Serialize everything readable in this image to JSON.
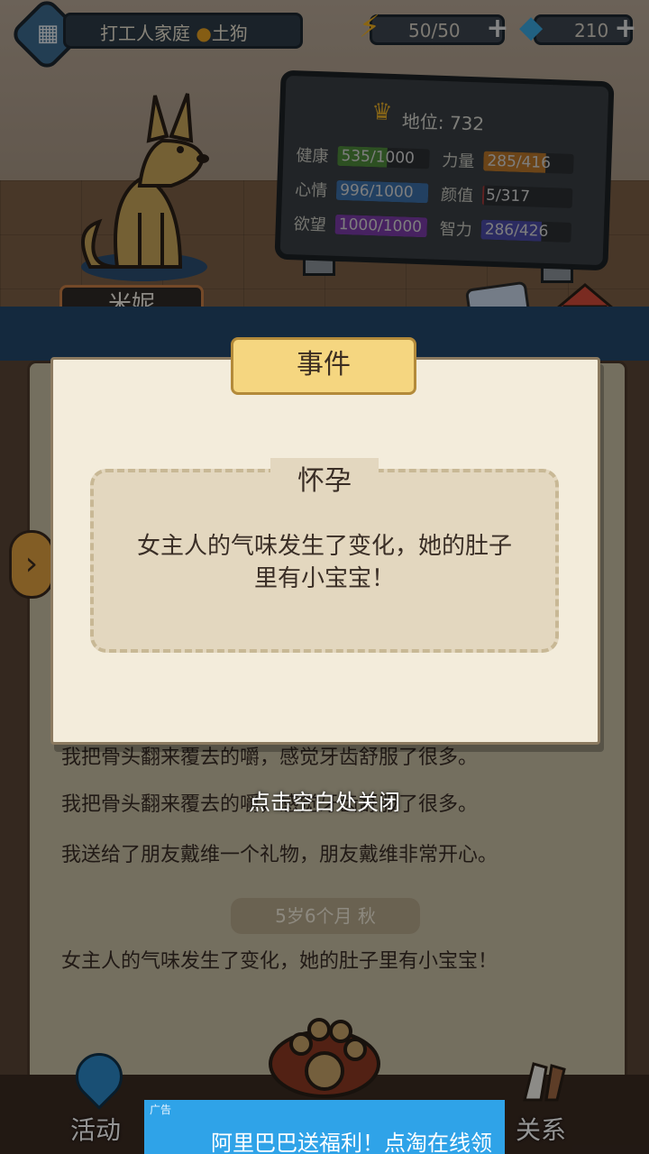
{
  "top_bar": {
    "family_name": "打工人家庭",
    "breed": "土狗",
    "energy": "50/50",
    "gems": "210"
  },
  "dog": {
    "name": "米妮"
  },
  "status": {
    "title": "地位: 732",
    "stats_left": [
      {
        "label": "健康",
        "value": "535/1000",
        "level": 0.535,
        "color": "#4f8a3c"
      },
      {
        "label": "心情",
        "value": "996/1000",
        "level": 0.996,
        "color": "#3c6fa8"
      },
      {
        "label": "欲望",
        "value": "1000/1000",
        "level": 1.0,
        "color": "#7a3ca8"
      }
    ],
    "stats_right": [
      {
        "label": "力量",
        "value": "285/416",
        "level": 0.685,
        "color": "#b8762a"
      },
      {
        "label": "颜值",
        "value": "5/317",
        "level": 0.016,
        "color": "#a83c3c"
      },
      {
        "label": "智力",
        "value": "286/426",
        "level": 0.671,
        "color": "#4a4aa8"
      }
    ]
  },
  "side_icons": {
    "task": "任务",
    "kennel": "狗窝"
  },
  "event": {
    "header": "事件",
    "title": "怀孕",
    "body": "女主人的气味发生了变化，她的肚子里有小宝宝！"
  },
  "log": {
    "lines": [
      "我把骨头翻来覆去的嚼，感觉牙齿舒服了很多。",
      "我把骨头翻来覆去的嚼，感觉牙齿舒服了很多。",
      "我送给了朋友戴维一个礼物，朋友戴维非常开心。"
    ],
    "date": "5岁6个月 秋",
    "last_line": "女主人的气味发生了变化，她的肚子里有小宝宝！"
  },
  "close_hint": "点击空白处关闭",
  "bottom_nav": {
    "activity": "活动",
    "relation": "关系"
  },
  "ad": {
    "tag": "广告",
    "text": "阿里巴巴送福利！点淘在线领"
  }
}
